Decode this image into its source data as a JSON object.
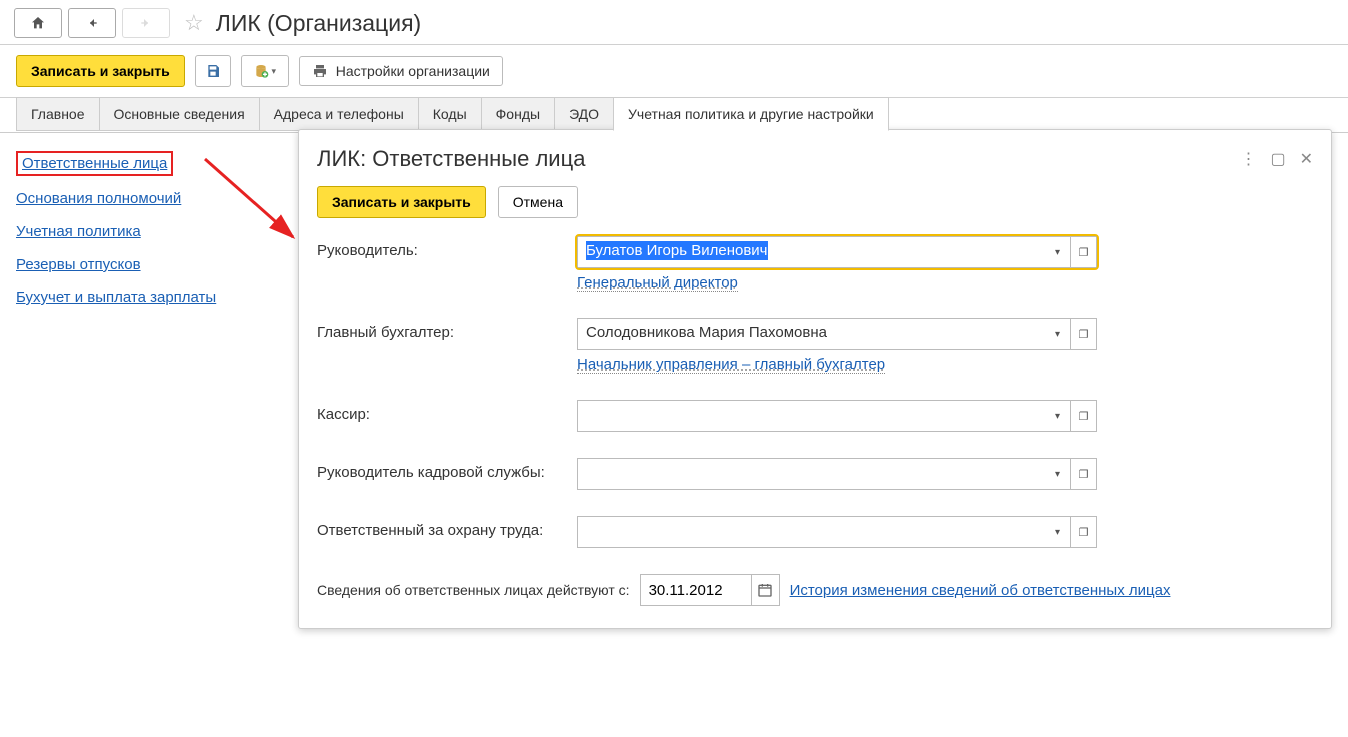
{
  "header": {
    "title": "ЛИК (Организация)"
  },
  "toolbar": {
    "save_close": "Записать и закрыть",
    "settings_label": "Настройки организации"
  },
  "tabs": [
    {
      "label": "Главное"
    },
    {
      "label": "Основные сведения"
    },
    {
      "label": "Адреса и телефоны"
    },
    {
      "label": "Коды"
    },
    {
      "label": "Фонды"
    },
    {
      "label": "ЭДО"
    },
    {
      "label": "Учетная политика и другие настройки",
      "active": true
    }
  ],
  "sidebar": {
    "items": [
      {
        "label": "Ответственные лица",
        "active": true
      },
      {
        "label": "Основания полномочий"
      },
      {
        "label": "Учетная политика"
      },
      {
        "label": "Резервы отпусков"
      },
      {
        "label": "Бухучет и выплата зарплаты"
      }
    ]
  },
  "panel": {
    "title": "ЛИК: Ответственные лица",
    "save_close": "Записать и закрыть",
    "cancel": "Отмена",
    "fields": {
      "head": {
        "label": "Руководитель:",
        "value": "Булатов Игорь Виленович",
        "sub": "Генеральный директор "
      },
      "accountant": {
        "label": "Главный бухгалтер:",
        "value": "Солодовникова Мария Пахомовна",
        "sub": "Начальник управления – главный бухгалтер "
      },
      "cashier": {
        "label": "Кассир:",
        "value": ""
      },
      "hr_head": {
        "label": "Руководитель кадровой службы:",
        "value": ""
      },
      "safety": {
        "label": "Ответственный за охрану труда:",
        "value": ""
      }
    },
    "footer": {
      "date_label": "Сведения об ответственных лицах действуют с:",
      "date_value": "30.11.2012",
      "history": "История изменения сведений об ответственных лицах"
    }
  }
}
